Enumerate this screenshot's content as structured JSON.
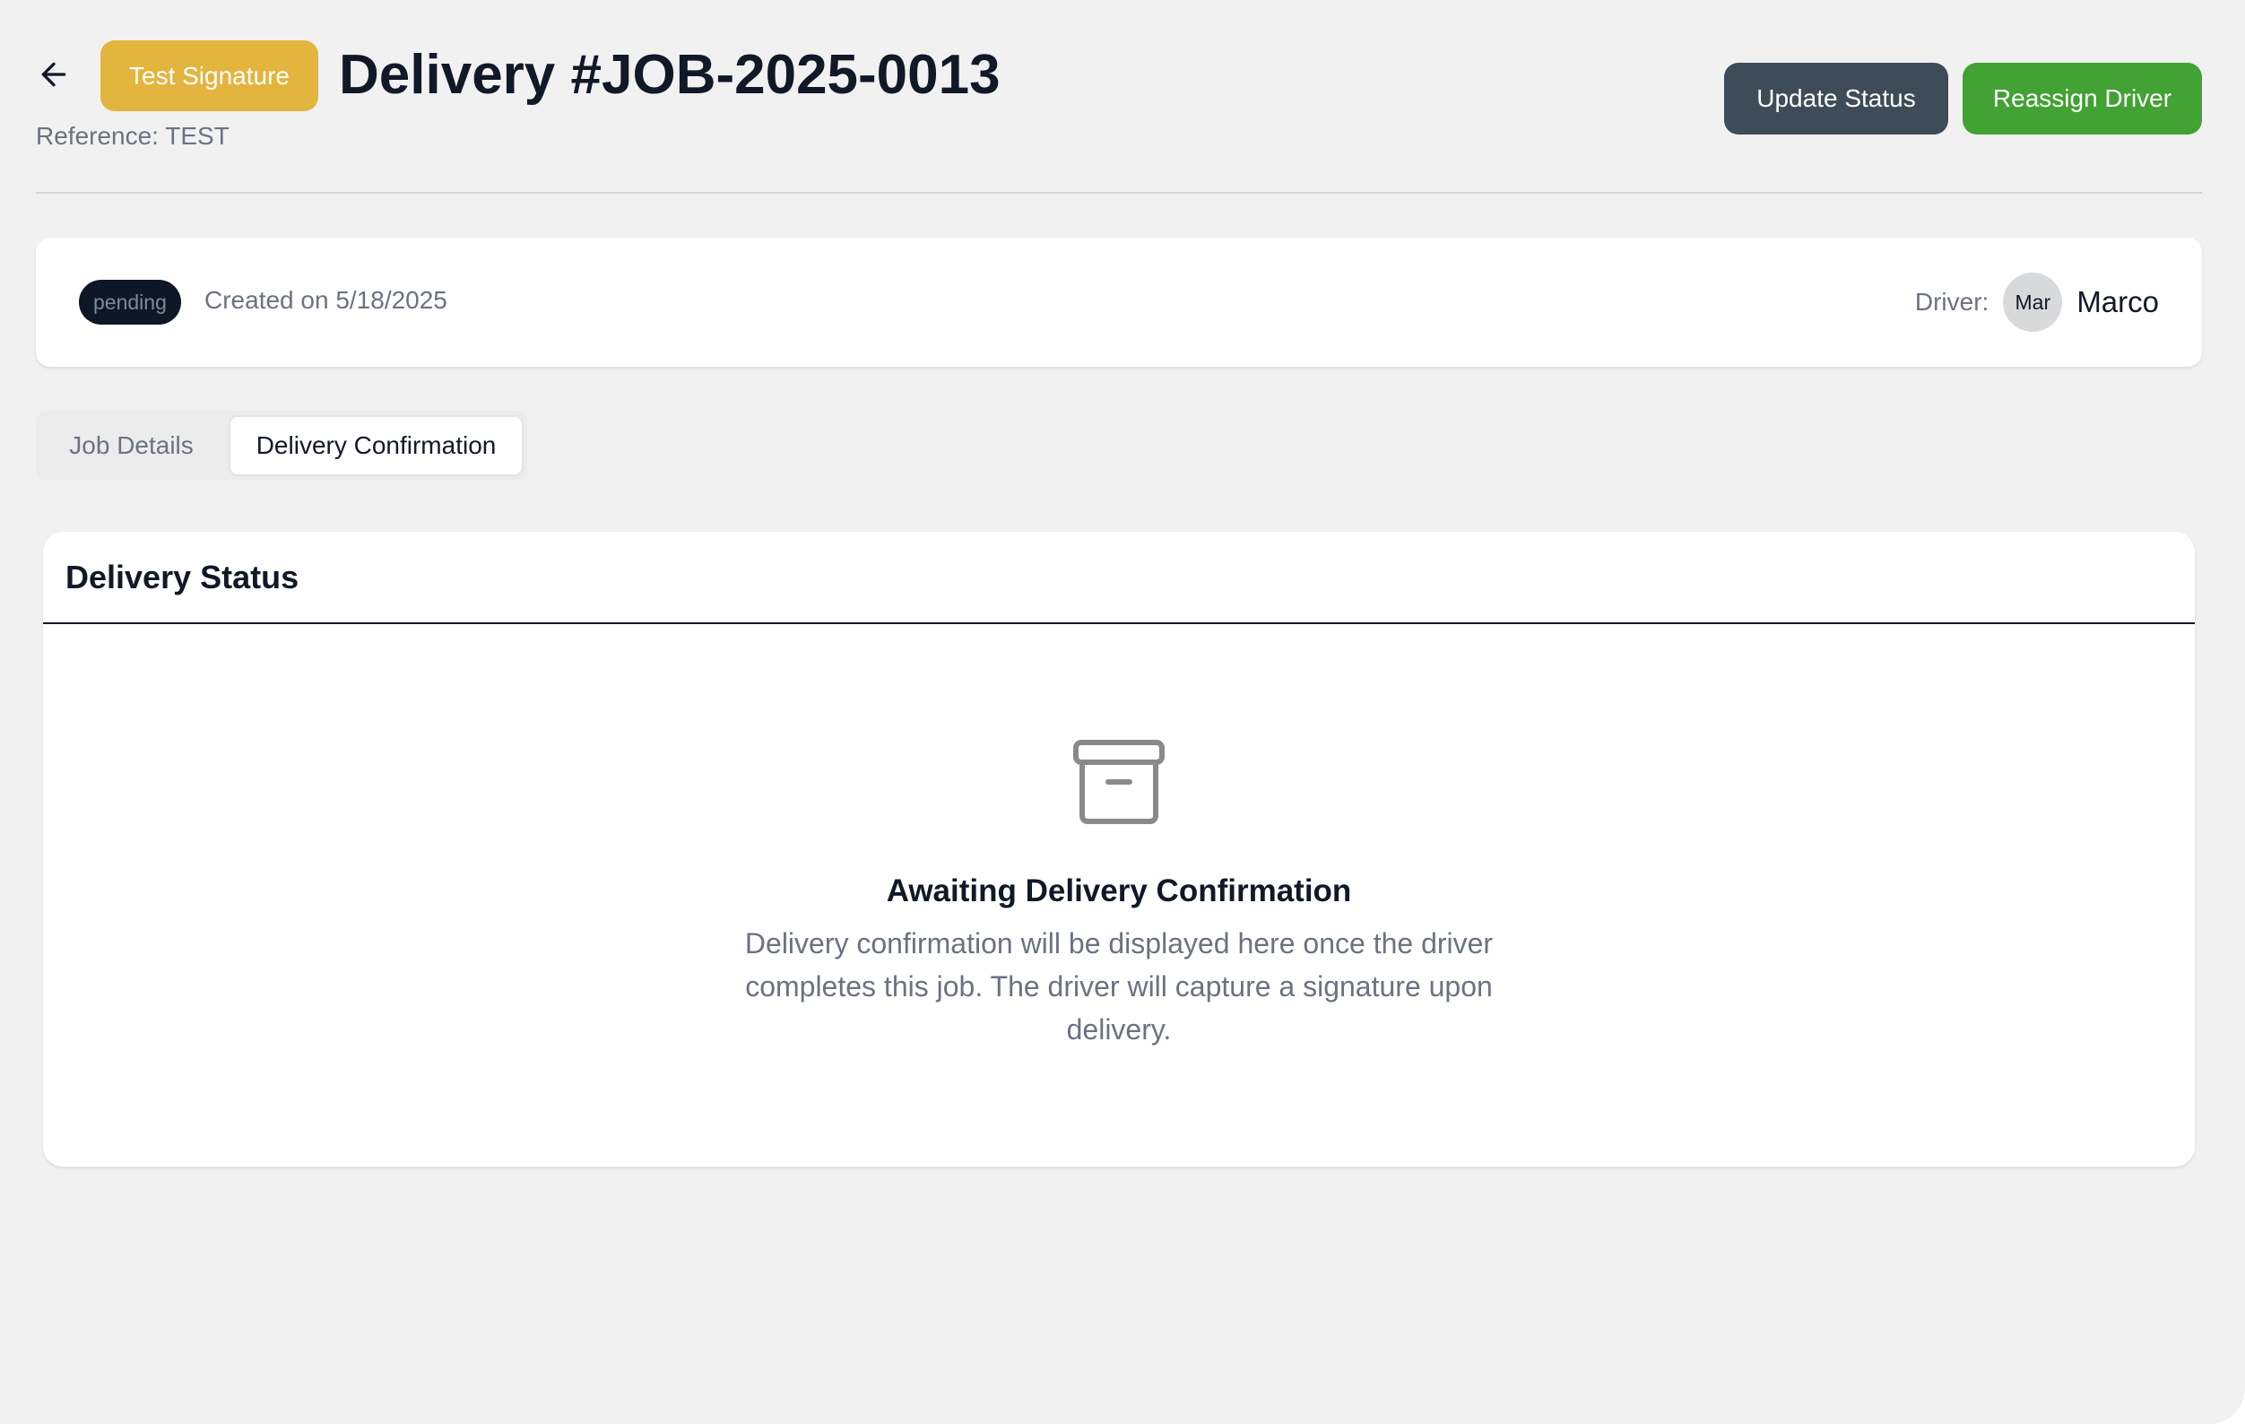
{
  "header": {
    "back_icon": "arrow-left-icon",
    "tag_label": "Test Signature",
    "title": "Delivery #JOB-2025-0013",
    "reference": "Reference: TEST",
    "actions": {
      "update_status": "Update Status",
      "reassign_driver": "Reassign Driver"
    }
  },
  "info": {
    "status": "pending",
    "created": "Created on 5/18/2025",
    "driver_label": "Driver:",
    "driver_initials": "Mar",
    "driver_name": "Marco"
  },
  "tabs": [
    {
      "label": "Job Details",
      "active": false
    },
    {
      "label": "Delivery Confirmation",
      "active": true
    }
  ],
  "status_card": {
    "title": "Delivery Status",
    "empty_icon": "archive-icon",
    "empty_title": "Awaiting Delivery Confirmation",
    "empty_description": "Delivery confirmation will be displayed here once the driver completes this job. The driver will capture a signature upon delivery."
  },
  "colors": {
    "tag": "#e3b53e",
    "update_status": "#3e4b58",
    "reassign_driver": "#42a233",
    "status_badge_bg": "#0e1725"
  }
}
